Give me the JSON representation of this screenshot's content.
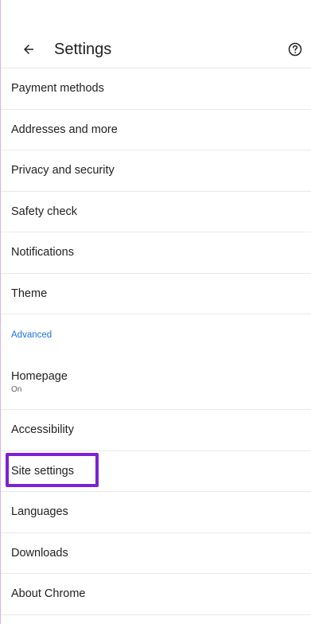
{
  "header": {
    "title": "Settings",
    "back_icon": "arrow-left-icon",
    "help_icon": "help-circle-icon"
  },
  "items": [
    {
      "label": "Payment methods"
    },
    {
      "label": "Addresses and more"
    },
    {
      "label": "Privacy and security"
    },
    {
      "label": "Safety check"
    },
    {
      "label": "Notifications"
    },
    {
      "label": "Theme"
    }
  ],
  "section_label": "Advanced",
  "advanced_items": [
    {
      "label": "Homepage",
      "sublabel": "On"
    },
    {
      "label": "Accessibility"
    },
    {
      "label": "Site settings",
      "highlighted": true
    },
    {
      "label": "Languages"
    },
    {
      "label": "Downloads"
    },
    {
      "label": "About Chrome"
    }
  ],
  "colors": {
    "accent": "#1a73e8",
    "highlight": "#7b22d4"
  }
}
